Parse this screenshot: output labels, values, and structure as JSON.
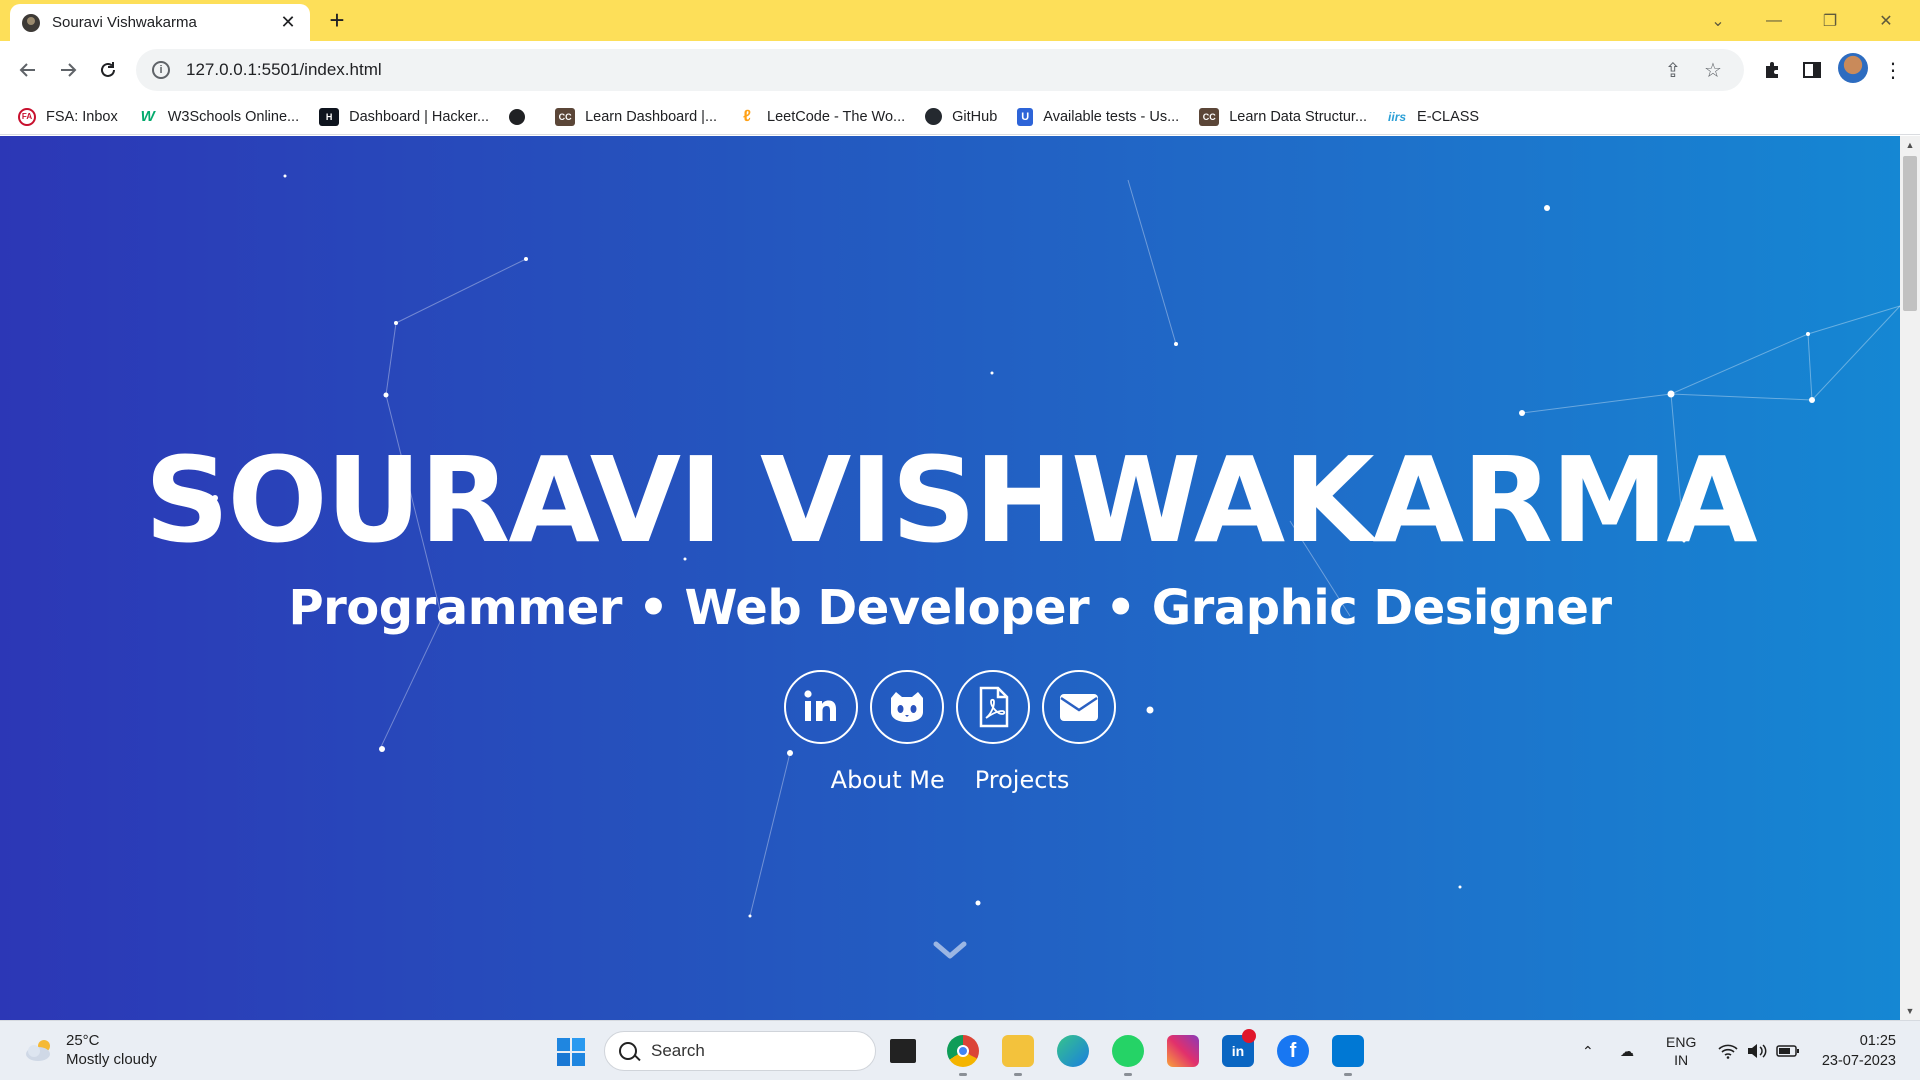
{
  "browser": {
    "tab_title": "Souravi Vishwakarma",
    "tab_close": "✕",
    "new_tab": "+",
    "url": "127.0.0.1:5501/index.html"
  },
  "bookmarks": [
    {
      "label": "FSA: Inbox",
      "icon": "fsa-icon",
      "color": "#c8102e"
    },
    {
      "label": "W3Schools Online...",
      "icon": "w3schools-icon",
      "color": "#04aa6d"
    },
    {
      "label": "Dashboard | Hacker...",
      "icon": "hackerrank-icon",
      "color": "#1ba94c"
    },
    {
      "label": "",
      "icon": "globe-icon",
      "color": "#202124"
    },
    {
      "label": "Learn Dashboard |...",
      "icon": "codechef-icon",
      "color": "#5b4638"
    },
    {
      "label": "LeetCode - The Wo...",
      "icon": "leetcode-icon",
      "color": "#ffa116"
    },
    {
      "label": "GitHub",
      "icon": "github-icon",
      "color": "#24292f"
    },
    {
      "label": "Available tests - Us...",
      "icon": "test-platform-icon",
      "color": "#2d64d8"
    },
    {
      "label": "Learn Data Structur...",
      "icon": "codechef-icon",
      "color": "#5b4638"
    },
    {
      "label": "E-CLASS",
      "icon": "iirs-icon",
      "color": "#2a9fd6"
    }
  ],
  "hero": {
    "name": "SOURAVI VISHWAKARMA",
    "subtitle": "Programmer • Web Developer • Graphic Designer",
    "socials": [
      {
        "name": "linkedin",
        "icon": "linkedin-icon"
      },
      {
        "name": "github",
        "icon": "github-icon"
      },
      {
        "name": "resume",
        "icon": "pdf-icon"
      },
      {
        "name": "email",
        "icon": "envelope-icon"
      }
    ],
    "links": [
      "About Me",
      "Projects"
    ],
    "colors": {
      "gradient_start": "#2c37b6",
      "gradient_end": "#1587d3",
      "text": "#ffffff"
    }
  },
  "taskbar": {
    "weather_temp": "25°C",
    "weather_desc": "Mostly cloudy",
    "search_placeholder": "Search",
    "language_line1": "ENG",
    "language_line2": "IN",
    "time": "01:25",
    "date": "23-07-2023",
    "pinned": [
      "task-view",
      "chrome",
      "file-explorer",
      "edge",
      "whatsapp",
      "instagram",
      "linkedin",
      "facebook",
      "vscode"
    ]
  }
}
